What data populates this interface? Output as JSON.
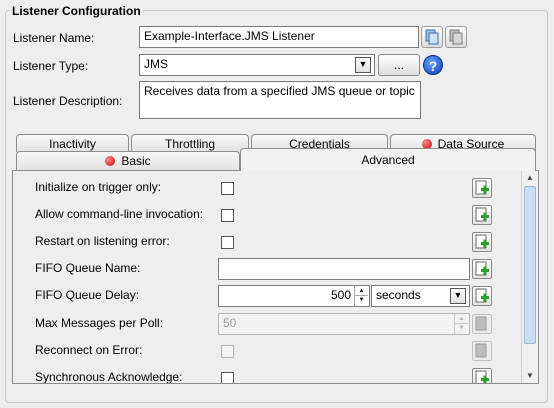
{
  "group": {
    "title": "Listener Configuration"
  },
  "fields": {
    "name": {
      "label": "Listener Name:",
      "value": "Example-Interface.JMS Listener"
    },
    "type": {
      "label": "Listener Type:",
      "value": "JMS",
      "dots_label": "...",
      "help_label": "?"
    },
    "description": {
      "label": "Listener Description:",
      "value": "Receives data from a specified JMS queue or topic"
    }
  },
  "tabs": {
    "row_top": [
      {
        "label": "Inactivity",
        "error": false
      },
      {
        "label": "Throttling",
        "error": false
      },
      {
        "label": "Credentials",
        "error": false
      },
      {
        "label": "Data Source",
        "error": true
      }
    ],
    "row_bottom": [
      {
        "label": "Basic",
        "error": true
      },
      {
        "label": "Advanced",
        "error": false,
        "selected": true
      }
    ]
  },
  "advanced": {
    "initialize_on_trigger": {
      "label": "Initialize on trigger only:",
      "checked": false
    },
    "allow_cmdline": {
      "label": "Allow command-line invocation:",
      "checked": false
    },
    "restart_on_error": {
      "label": "Restart on listening error:",
      "checked": false
    },
    "fifo_queue_name": {
      "label": "FIFO Queue Name:",
      "value": ""
    },
    "fifo_queue_delay": {
      "label": "FIFO Queue Delay:",
      "value": "500",
      "unit": "seconds"
    },
    "max_messages": {
      "label": "Max Messages per Poll:",
      "value": "50",
      "enabled": false
    },
    "reconnect_on_error": {
      "label": "Reconnect on Error:",
      "checked": false,
      "enabled": false
    },
    "sync_ack": {
      "label": "Synchronous Acknowledge:",
      "checked": false
    }
  },
  "colors": {
    "error_dot": "#cc0000",
    "help_icon": "#0d3fb8",
    "add_icon": "#2e9e2e"
  }
}
